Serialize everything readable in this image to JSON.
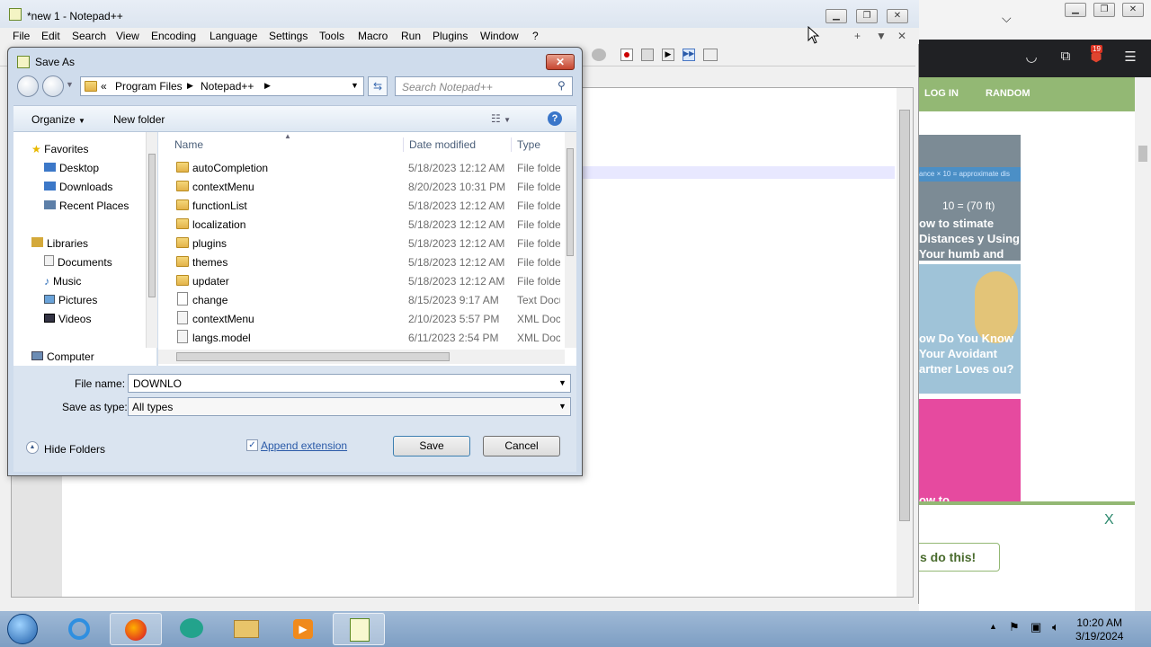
{
  "notepad": {
    "title": "*new 1 - Notepad++",
    "menu": [
      "File",
      "Edit",
      "Search",
      "View",
      "Encoding",
      "Language",
      "Settings",
      "Tools",
      "Macro",
      "Run",
      "Plugins",
      "Window",
      "?"
    ],
    "tabbar_controls": [
      "+",
      "▼",
      "✕"
    ]
  },
  "browser": {
    "notification_count": "19",
    "nav": [
      "LOG IN",
      "RANDOM"
    ],
    "cards": [
      {
        "formula": "ance × 10 = approximate dis",
        "formula2": "10 = (70 ft)",
        "text": "ow to stimate Distances y Using Your humb and Eyes)"
      },
      {
        "text": "ow Do You Know Your Avoidant artner Loves ou?"
      },
      {
        "text": "ow to"
      }
    ],
    "banner_close": "X",
    "banner_button": "s do this!"
  },
  "dialog": {
    "title": "Save As",
    "breadcrumb": [
      "«",
      "Program Files",
      "Notepad++"
    ],
    "search_placeholder": "Search Notepad++",
    "organize_label": "Organize",
    "new_folder_label": "New folder",
    "nav_tree": {
      "favorites": "Favorites",
      "favorite_items": [
        "Desktop",
        "Downloads",
        "Recent Places"
      ],
      "libraries": "Libraries",
      "library_items": [
        "Documents",
        "Music",
        "Pictures",
        "Videos"
      ],
      "computer": "Computer"
    },
    "columns": {
      "name": "Name",
      "date": "Date modified",
      "type": "Type"
    },
    "files": [
      {
        "name": "autoCompletion",
        "date": "5/18/2023 12:12 AM",
        "type": "File folder",
        "kind": "folder"
      },
      {
        "name": "contextMenu",
        "date": "8/20/2023 10:31 PM",
        "type": "File folder",
        "kind": "folder"
      },
      {
        "name": "functionList",
        "date": "5/18/2023 12:12 AM",
        "type": "File folder",
        "kind": "folder"
      },
      {
        "name": "localization",
        "date": "5/18/2023 12:12 AM",
        "type": "File folder",
        "kind": "folder"
      },
      {
        "name": "plugins",
        "date": "5/18/2023 12:12 AM",
        "type": "File folder",
        "kind": "folder"
      },
      {
        "name": "themes",
        "date": "5/18/2023 12:12 AM",
        "type": "File folder",
        "kind": "folder"
      },
      {
        "name": "updater",
        "date": "5/18/2023 12:12 AM",
        "type": "File folder",
        "kind": "folder"
      },
      {
        "name": "change",
        "date": "8/15/2023 9:17 AM",
        "type": "Text Document",
        "kind": "doc"
      },
      {
        "name": "contextMenu",
        "date": "2/10/2023 5:57 PM",
        "type": "XML Document",
        "kind": "xml"
      },
      {
        "name": "langs.model",
        "date": "6/11/2023 2:54 PM",
        "type": "XML Document",
        "kind": "xml"
      }
    ],
    "file_name_label": "File name:",
    "file_name_value": "DOWNLO",
    "save_type_label": "Save as type:",
    "save_type_value": "All types",
    "hide_folders_label": "Hide Folders",
    "append_extension_label": "Append extension",
    "append_extension_checked": true,
    "save_label": "Save",
    "cancel_label": "Cancel"
  },
  "taskbar": {
    "time": "10:20 AM",
    "date": "3/19/2024"
  }
}
